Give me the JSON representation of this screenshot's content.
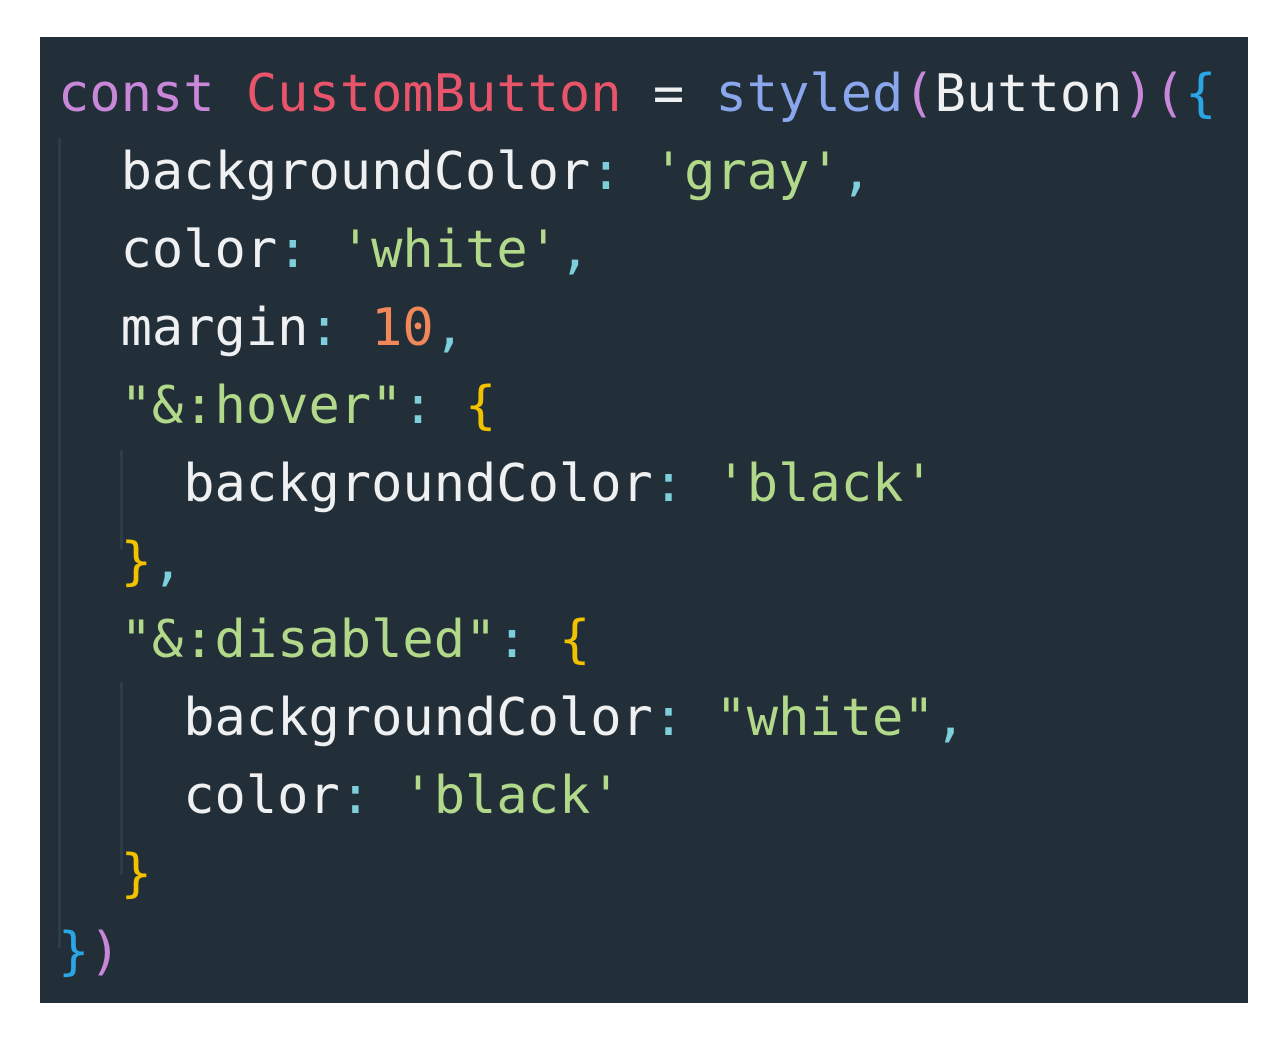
{
  "colors": {
    "background": "#232f38",
    "keyword": "#c987d9",
    "variable": "#e8546a",
    "operator": "#eef0f2",
    "function": "#8aa6ec",
    "plain": "#eef0f2",
    "paren_outer": "#c987d9",
    "brace_outer": "#2aa6e6",
    "brace_inner": "#f2c200",
    "punct": "#7dcfdb",
    "string": "#b2d88a",
    "number": "#f2875a",
    "guide": "#2f3c46"
  },
  "code": {
    "lines": [
      {
        "tokens": [
          {
            "text": "const",
            "kind": "keyword"
          },
          {
            "text": " ",
            "kind": "plain"
          },
          {
            "text": "CustomButton",
            "kind": "variable"
          },
          {
            "text": " ",
            "kind": "plain"
          },
          {
            "text": "=",
            "kind": "operator"
          },
          {
            "text": " ",
            "kind": "plain"
          },
          {
            "text": "styled",
            "kind": "function"
          },
          {
            "text": "(",
            "kind": "paren_outer"
          },
          {
            "text": "Button",
            "kind": "plain"
          },
          {
            "text": ")(",
            "kind": "paren_outer"
          },
          {
            "text": "{",
            "kind": "brace_outer"
          }
        ]
      },
      {
        "tokens": [
          {
            "text": "  ",
            "kind": "plain"
          },
          {
            "text": "backgroundColor",
            "kind": "plain"
          },
          {
            "text": ":",
            "kind": "punct"
          },
          {
            "text": " ",
            "kind": "plain"
          },
          {
            "text": "'gray'",
            "kind": "string"
          },
          {
            "text": ",",
            "kind": "punct"
          }
        ]
      },
      {
        "tokens": [
          {
            "text": "  ",
            "kind": "plain"
          },
          {
            "text": "color",
            "kind": "plain"
          },
          {
            "text": ":",
            "kind": "punct"
          },
          {
            "text": " ",
            "kind": "plain"
          },
          {
            "text": "'white'",
            "kind": "string"
          },
          {
            "text": ",",
            "kind": "punct"
          }
        ]
      },
      {
        "tokens": [
          {
            "text": "  ",
            "kind": "plain"
          },
          {
            "text": "margin",
            "kind": "plain"
          },
          {
            "text": ":",
            "kind": "punct"
          },
          {
            "text": " ",
            "kind": "plain"
          },
          {
            "text": "10",
            "kind": "number"
          },
          {
            "text": ",",
            "kind": "punct"
          }
        ]
      },
      {
        "tokens": [
          {
            "text": "  ",
            "kind": "plain"
          },
          {
            "text": "\"&:hover\"",
            "kind": "string"
          },
          {
            "text": ":",
            "kind": "punct"
          },
          {
            "text": " ",
            "kind": "plain"
          },
          {
            "text": "{",
            "kind": "brace_inner"
          }
        ]
      },
      {
        "tokens": [
          {
            "text": "    ",
            "kind": "plain"
          },
          {
            "text": "backgroundColor",
            "kind": "plain"
          },
          {
            "text": ":",
            "kind": "punct"
          },
          {
            "text": " ",
            "kind": "plain"
          },
          {
            "text": "'black'",
            "kind": "string"
          }
        ]
      },
      {
        "tokens": [
          {
            "text": "  ",
            "kind": "plain"
          },
          {
            "text": "}",
            "kind": "brace_inner"
          },
          {
            "text": ",",
            "kind": "punct"
          }
        ]
      },
      {
        "tokens": [
          {
            "text": "  ",
            "kind": "plain"
          },
          {
            "text": "\"&:disabled\"",
            "kind": "string"
          },
          {
            "text": ":",
            "kind": "punct"
          },
          {
            "text": " ",
            "kind": "plain"
          },
          {
            "text": "{",
            "kind": "brace_inner"
          }
        ]
      },
      {
        "tokens": [
          {
            "text": "    ",
            "kind": "plain"
          },
          {
            "text": "backgroundColor",
            "kind": "plain"
          },
          {
            "text": ":",
            "kind": "punct"
          },
          {
            "text": " ",
            "kind": "plain"
          },
          {
            "text": "\"white\"",
            "kind": "string"
          },
          {
            "text": ",",
            "kind": "punct"
          }
        ]
      },
      {
        "tokens": [
          {
            "text": "    ",
            "kind": "plain"
          },
          {
            "text": "color",
            "kind": "plain"
          },
          {
            "text": ":",
            "kind": "punct"
          },
          {
            "text": " ",
            "kind": "plain"
          },
          {
            "text": "'black'",
            "kind": "string"
          }
        ]
      },
      {
        "tokens": [
          {
            "text": "  ",
            "kind": "plain"
          },
          {
            "text": "}",
            "kind": "brace_inner"
          }
        ]
      },
      {
        "tokens": [
          {
            "text": "}",
            "kind": "brace_outer"
          },
          {
            "text": ")",
            "kind": "paren_outer"
          }
        ]
      }
    ]
  }
}
